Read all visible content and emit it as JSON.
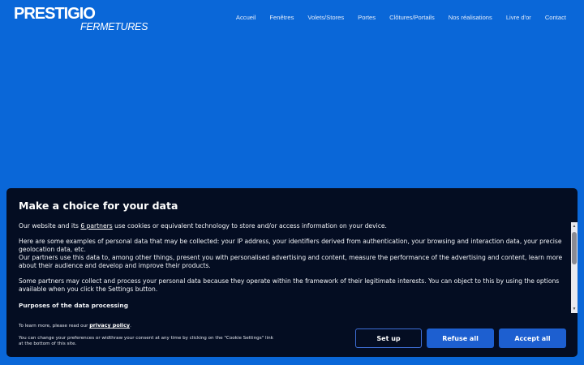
{
  "header": {
    "logo_top": "PRESTIGIO",
    "logo_bottom": "FERMETURES",
    "nav": [
      "Accueil",
      "Fenêtres",
      "Volets/Stores",
      "Portes",
      "Clôtures/Portails",
      "Nos réalisations",
      "Livre d'or",
      "Contact"
    ]
  },
  "consent": {
    "title": "Make a choice for your data",
    "p1_before": "Our website and its ",
    "p1_link": "6 partners",
    "p1_after": " use cookies or equivalent technology to store and/or access information on your device.",
    "p2": "Here are some examples of personal data that may be collected: your IP address, your identifiers derived from authentication, your browsing and interaction data, your precise geolocation data, etc.",
    "p3": "Our partners use this data to, among other things, present you with personalised advertising and content, measure the performance of the advertising and content, learn more about their audience and develop and improve their products.",
    "p4": "Some partners may collect and process your personal data because they operate within the framework of their legitimate interests. You can object to this by using the options available when you click the Settings button.",
    "purposes_heading": "Purposes of the data processing",
    "note1_before": "To learn more, please read our ",
    "note1_link": "privacy policy",
    "note1_after": ".",
    "note2": "You can change your preferences or widthraw your consent at any time by clicking on the \"Cookie Settings\" link at the bottom of this site.",
    "btn_setup": "Set up",
    "btn_refuse": "Refuse all",
    "btn_accept": "Accept all"
  },
  "colors": {
    "page_bg": "#0a67d8",
    "panel_bg": "#040d22",
    "button_bg": "#1d5fd0"
  }
}
